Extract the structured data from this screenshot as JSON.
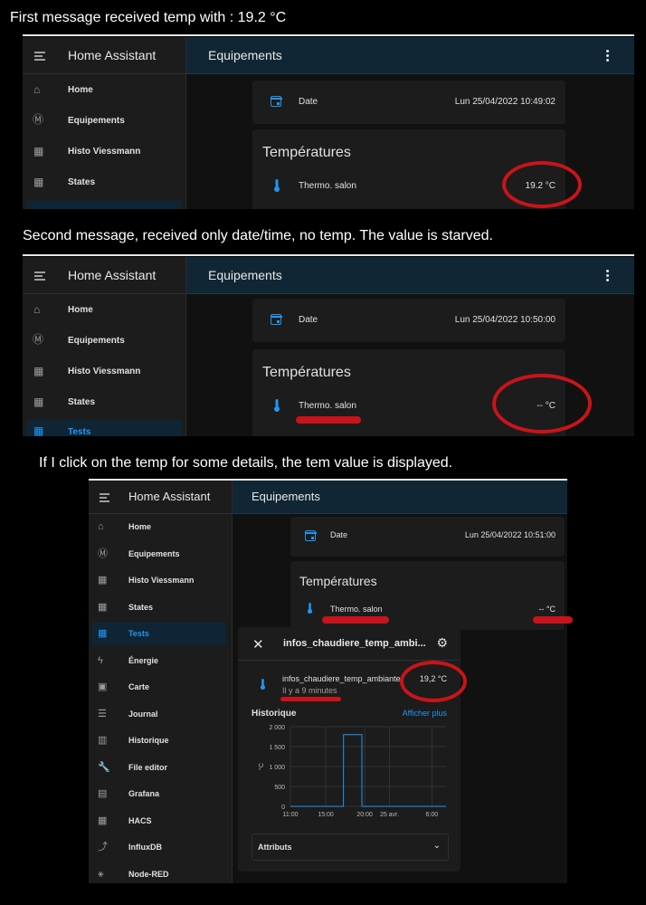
{
  "captions": {
    "first": "First message received temp with : 19.2 °C",
    "second": "Second message, received only date/time, no temp. The value is starved.",
    "third": "If I click on the temp for some details, the tem value is displayed."
  },
  "app": {
    "title": "Home Assistant",
    "page_title": "Equipements"
  },
  "shot1": {
    "sidebar": [
      "Home",
      "Equipements",
      "Histo Viessmann",
      "States"
    ],
    "date_label": "Date",
    "date_value": "Lun 25/04/2022 10:49:02",
    "card_title": "Températures",
    "sensor_label": "Thermo. salon",
    "sensor_value": "19.2 °C"
  },
  "shot2": {
    "sidebar": [
      "Home",
      "Equipements",
      "Histo Viessmann",
      "States",
      "Tests"
    ],
    "date_label": "Date",
    "date_value": "Lun 25/04/2022 10:50:00",
    "card_title": "Températures",
    "sensor_label": "Thermo. salon",
    "sensor_value": "-- °C"
  },
  "shot3": {
    "sidebar": [
      "Home",
      "Equipements",
      "Histo Viessmann",
      "States",
      "Tests",
      "Énergie",
      "Carte",
      "Journal",
      "Historique",
      "File editor",
      "Grafana",
      "HACS",
      "InfluxDB",
      "Node-RED"
    ],
    "date_label": "Date",
    "date_value": "Lun 25/04/2022 10:51:00",
    "card_title": "Températures",
    "sensor_label": "Thermo. salon",
    "sensor_value": "-- °C",
    "dialog": {
      "title": "infos_chaudiere_temp_ambi...",
      "entity": "infos_chaudiere_temp_ambiante",
      "ago": "Il y a 9 minutes",
      "value": "19,2 °C",
      "history_label": "Historique",
      "more_link": "Afficher plus",
      "attributes_label": "Attributs"
    }
  },
  "chart_data": {
    "type": "line",
    "ylabel": "°C",
    "y_ticks": [
      "0",
      "500",
      "1 000",
      "1 500",
      "2 000"
    ],
    "x_ticks": [
      "11:00",
      "15:00",
      "20:00",
      "25 avr.",
      "6:00"
    ],
    "ylim": [
      0,
      2000
    ],
    "x": [
      0,
      7.5,
      7.51,
      10.1,
      10.11,
      22
    ],
    "values": [
      0,
      0,
      1800,
      1800,
      0,
      0
    ],
    "color": "#2196f3"
  }
}
